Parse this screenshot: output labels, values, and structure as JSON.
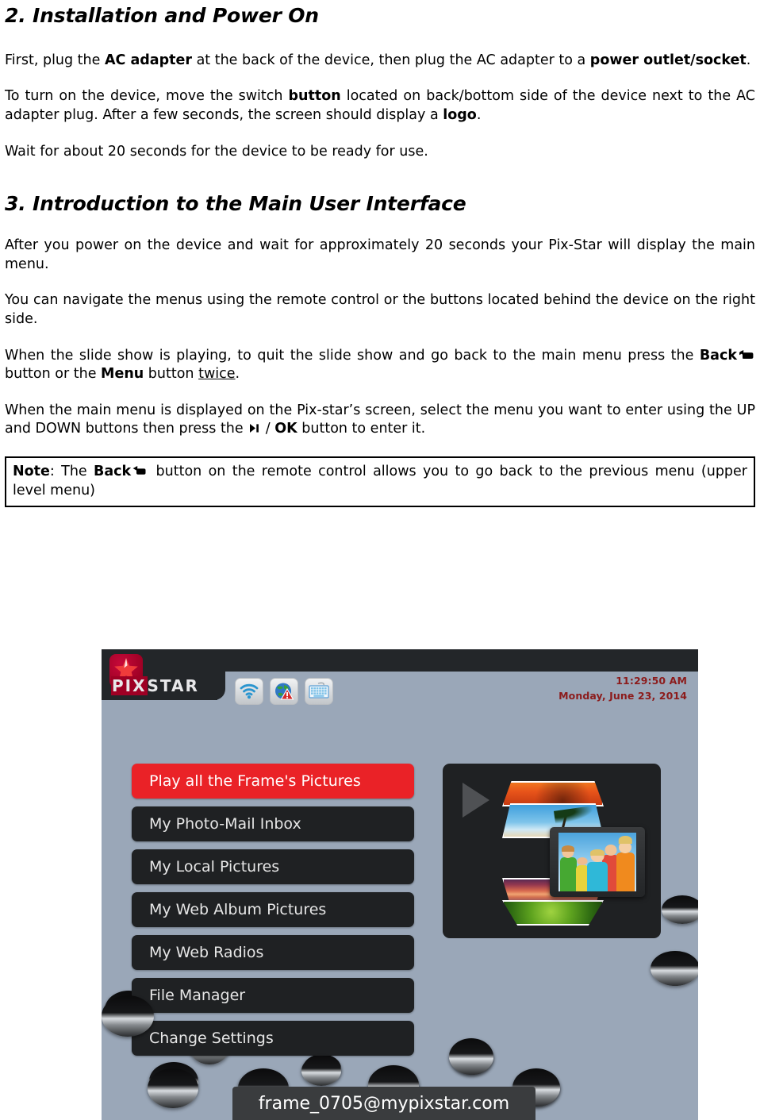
{
  "document": {
    "section2": {
      "heading": "2. Installation and Power On",
      "p1_a": "First, plug the ",
      "p1_b": "AC adapter",
      "p1_c": " at the back of the device, then plug the AC adapter to a ",
      "p1_d": "power outlet/socket",
      "p1_e": ".",
      "p2_a": "To turn on the device, move the switch ",
      "p2_b": "button",
      "p2_c": " located on back/bottom side of the device next to the AC adapter plug. After a few seconds, the screen should display a ",
      "p2_d": "logo",
      "p2_e": ".",
      "p3": "Wait for about 20 seconds for the device to be ready for use."
    },
    "section3": {
      "heading": "3. Introduction to the Main User Interface",
      "p1": "After you power on the device and wait for approximately 20 seconds your Pix-Star will display the main menu.",
      "p2": "You can navigate the menus using the remote control or the buttons located behind the device on the right side.",
      "p3_a": "When the slide show is playing, to quit the slide show and go back to the main menu press the ",
      "p3_b": "Back",
      "p3_c": " button or the ",
      "p3_d": "Menu",
      "p3_e": " button ",
      "p3_f": "twice",
      "p3_g": ".",
      "p4_a": "When the main menu is displayed on the Pix-star’s screen, select the menu you want to enter using the UP and DOWN buttons then press the ",
      "p4_b": " / ",
      "p4_c": "OK",
      "p4_d": " button to enter it."
    },
    "note": {
      "label": "Note",
      "a": ": The ",
      "b": "Back",
      "c": " button on the remote control allows you to go back to the previous menu (upper level menu)"
    }
  },
  "device_screenshot": {
    "brand": {
      "pix": "PIX",
      "star": "STAR",
      "star_icon": "star-icon"
    },
    "status_icons": [
      {
        "name": "wifi-icon",
        "label": "WiFi"
      },
      {
        "name": "globe-warning-icon",
        "label": "Network warning"
      },
      {
        "name": "keyboard-icon",
        "label": "Keyboard"
      }
    ],
    "clock": {
      "time": "11:29:50 AM",
      "date": "Monday, June 23, 2014",
      "color": "#8c1c1c"
    },
    "menu": {
      "active_index": 0,
      "active_color": "#ea2227",
      "item_color": "#1f2123",
      "items": [
        {
          "label": "Play all the Frame's Pictures"
        },
        {
          "label": "My Photo-Mail Inbox"
        },
        {
          "label": "My Local Pictures"
        },
        {
          "label": "My Web Album Pictures"
        },
        {
          "label": "My Web Radios"
        },
        {
          "label": "File Manager"
        },
        {
          "label": "Change Settings"
        }
      ]
    },
    "preview": {
      "play_icon": "play-arrow-icon",
      "slides": [
        "orange-leaves-photo",
        "palm-beach-photo",
        "kids-group-photo",
        "sunset-sea-photo",
        "green-fern-photo"
      ]
    },
    "email_bar": {
      "address": "frame_0705@mypixstar.com"
    },
    "background_color": "#9aa7b8"
  }
}
